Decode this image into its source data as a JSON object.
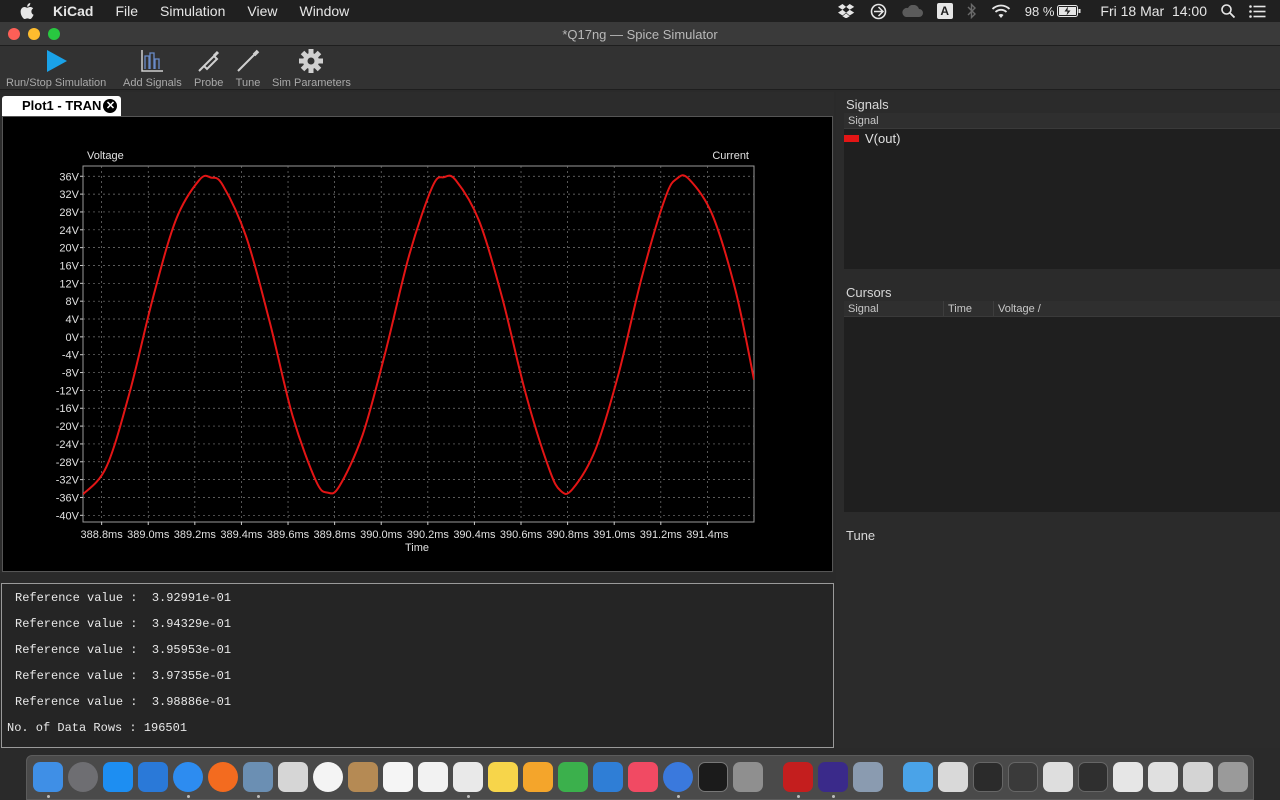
{
  "menubar": {
    "app": "KiCad",
    "items": [
      "File",
      "Simulation",
      "View",
      "Window"
    ],
    "battery": "98 %",
    "input_source": "A",
    "datetime": "Fri 18 Mar  14:00"
  },
  "window": {
    "title": "*Q17ng — Spice Simulator"
  },
  "toolbar": {
    "run_stop": "Run/Stop Simulation",
    "add_signals": "Add Signals",
    "probe": "Probe",
    "tune": "Tune",
    "sim_parameters": "Sim Parameters"
  },
  "tab": {
    "label": "Plot1 - TRAN"
  },
  "chart_data": {
    "type": "line",
    "ylabel": "Voltage",
    "y2label": "Current",
    "xlabel": "Time",
    "x_unit": "ms",
    "y_unit": "V",
    "xlim": [
      388.72,
      391.6
    ],
    "ylim": [
      -41.5,
      38.3
    ],
    "x_ticks": [
      388.8,
      389.0,
      389.2,
      389.4,
      389.6,
      389.8,
      390.0,
      390.2,
      390.4,
      390.6,
      390.8,
      391.0,
      391.2,
      391.4
    ],
    "x_tick_labels": [
      "388.8ms",
      "389.0ms",
      "389.2ms",
      "389.4ms",
      "389.6ms",
      "389.8ms",
      "390.0ms",
      "390.2ms",
      "390.4ms",
      "390.6ms",
      "390.8ms",
      "391.0ms",
      "391.2ms",
      "391.4ms"
    ],
    "y_ticks": [
      36,
      32,
      28,
      24,
      20,
      16,
      12,
      8,
      4,
      0,
      -4,
      -8,
      -12,
      -16,
      -20,
      -24,
      -28,
      -32,
      -36,
      -40
    ],
    "y_tick_labels": [
      "36V",
      "32V",
      "28V",
      "24V",
      "20V",
      "16V",
      "12V",
      "8V",
      "4V",
      "0V",
      "-4V",
      "-8V",
      "-12V",
      "-16V",
      "-20V",
      "-24V",
      "-28V",
      "-32V",
      "-36V",
      "-40V"
    ],
    "grid": true,
    "series": [
      {
        "name": "V(out)",
        "color": "#e31515",
        "x": [
          388.72,
          388.82,
          388.92,
          389.02,
          389.12,
          389.22,
          389.27,
          389.32,
          389.42,
          389.52,
          389.62,
          389.72,
          389.77,
          389.82,
          389.92,
          390.02,
          390.12,
          390.22,
          390.27,
          390.32,
          390.42,
          390.52,
          390.62,
          390.72,
          390.77,
          390.82,
          390.92,
          391.02,
          391.12,
          391.22,
          391.27,
          391.32,
          391.42,
          391.52,
          391.6
        ],
        "y": [
          -35.3,
          -29.2,
          -12.5,
          8.7,
          26.4,
          35.2,
          35.7,
          34.0,
          22.5,
          3.6,
          -17.8,
          -32.3,
          -34.9,
          -33.5,
          -22.0,
          -3.0,
          18.3,
          33.7,
          35.8,
          35.1,
          26.0,
          8.6,
          -12.7,
          -29.5,
          -34.5,
          -34.2,
          -25.2,
          -8.0,
          13.7,
          31.3,
          35.5,
          35.4,
          27.5,
          10.5,
          -9.6
        ]
      }
    ]
  },
  "console": {
    "lines": [
      "Reference value :  3.92991e-01",
      "Reference value :  3.94329e-01",
      "Reference value :  3.95953e-01",
      "Reference value :  3.97355e-01",
      "Reference value :  3.98886e-01"
    ],
    "data_rows": "No. of Data Rows : 196501"
  },
  "signals_panel": {
    "title": "Signals",
    "column": "Signal",
    "items": [
      {
        "name": "V(out)",
        "color": "#e31515"
      }
    ]
  },
  "cursors_panel": {
    "title": "Cursors",
    "columns": [
      "Signal",
      "Time",
      "Voltage /"
    ]
  },
  "tune_panel": {
    "title": "Tune"
  }
}
